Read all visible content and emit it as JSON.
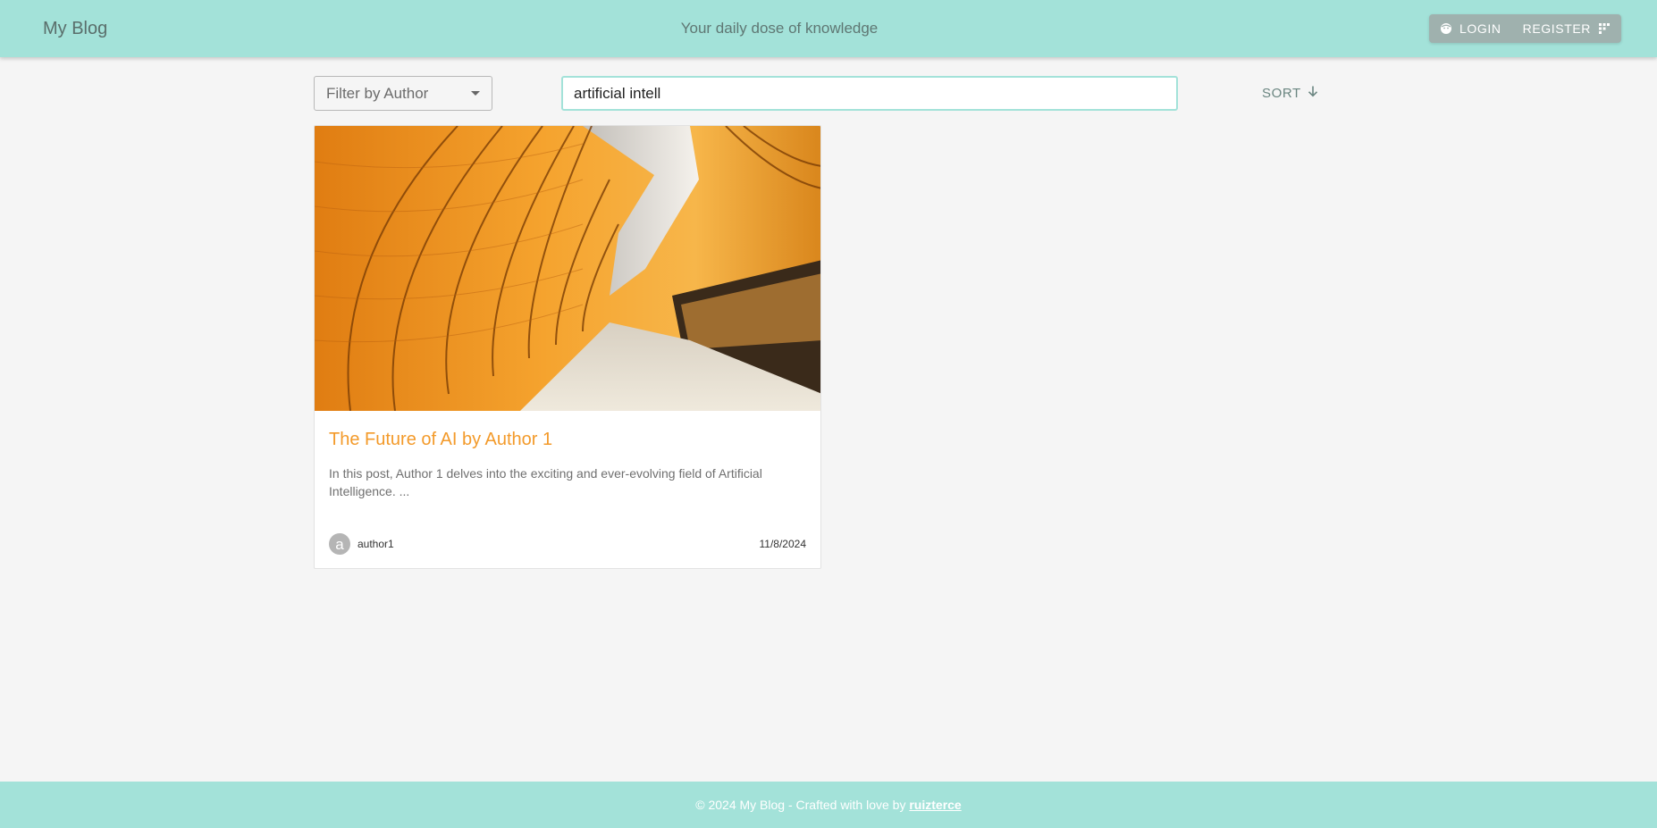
{
  "header": {
    "brand": "My Blog",
    "tagline": "Your daily dose of knowledge",
    "login_label": "LOGIN",
    "register_label": "REGISTER",
    "login_icon": "face-icon",
    "register_icon": "grid-icon"
  },
  "toolbar": {
    "author_filter_placeholder": "Filter by Author",
    "search_value": "artificial intell",
    "sort_label": "SORT",
    "sort_icon": "arrow-down-icon"
  },
  "posts": [
    {
      "title": "The Future of AI by Author 1",
      "excerpt": "In this post, Author 1 delves into the exciting and ever-evolving field of Artificial Intelligence. ...",
      "avatar_letter": "a",
      "author": "author1",
      "date": "11/8/2024"
    }
  ],
  "footer": {
    "text": "© 2024 My Blog - Crafted with love by ",
    "link_label": "ruizterce"
  },
  "colors": {
    "header_bg": "#a3e2d9",
    "title_accent": "#f39a2a",
    "auth_buttons_bg": "#9fb1ae"
  }
}
